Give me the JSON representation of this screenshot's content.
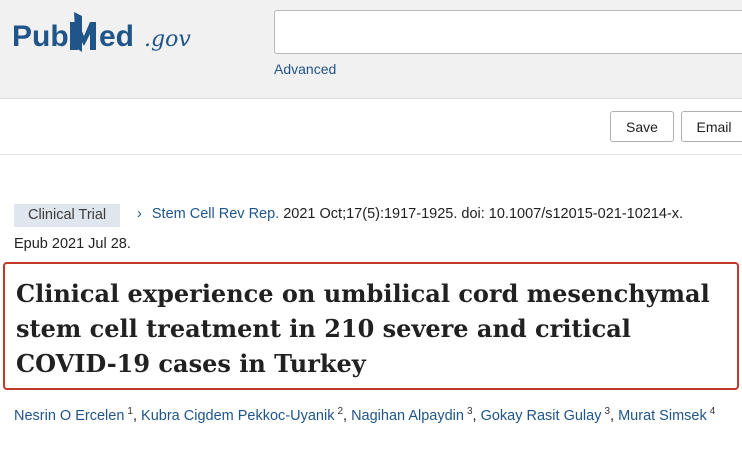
{
  "header": {
    "logo": {
      "pub": "Pub",
      "m": "M",
      "ed": "ed",
      "gov": ".gov"
    },
    "search": {
      "placeholder": ""
    },
    "advanced_label": "Advanced"
  },
  "actions": {
    "save_label": "Save",
    "email_label": "Email"
  },
  "article": {
    "publication_type": "Clinical Trial",
    "journal": "Stem Cell Rev Rep.",
    "citation_rest": "2021 Oct;17(5):1917-1925. doi: 10.1007/s12015-021-10214-x.",
    "epub": "Epub 2021 Jul 28.",
    "title": "Clinical experience on umbilical cord mesenchymal stem cell treatment in 210 severe and critical COVID-19 cases in Turkey",
    "authors": [
      {
        "name": "Nesrin O Ercelen",
        "aff": "1"
      },
      {
        "name": "Kubra Cigdem Pekkoc-Uyanik",
        "aff": "2"
      },
      {
        "name": "Nagihan Alpaydin",
        "aff": "3"
      },
      {
        "name": "Gokay Rasit Gulay",
        "aff": "3"
      },
      {
        "name": "Murat Simsek",
        "aff": "4"
      }
    ]
  },
  "colors": {
    "pubmed_blue": "#20558a",
    "title_highlight": "#c0392b",
    "header_bg": "#f1f1f1"
  }
}
